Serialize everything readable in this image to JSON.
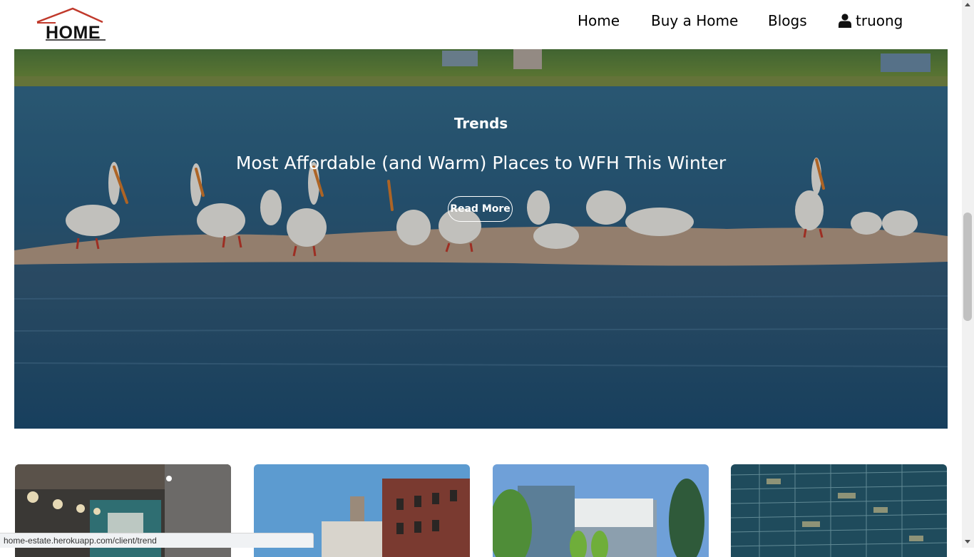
{
  "header": {
    "logo_text": "HOME",
    "nav": {
      "home": "Home",
      "buy": "Buy a Home",
      "blogs": "Blogs",
      "user": "truong"
    },
    "user_icon": "user-icon"
  },
  "hero": {
    "category": "Trends",
    "title": "Most Affordable (and Warm) Places to WFH This Winter",
    "read_more": "Read More"
  },
  "cards": [
    {
      "image": "interior-cafe"
    },
    {
      "image": "brick-buildings"
    },
    {
      "image": "glass-office"
    },
    {
      "image": "glass-tower"
    }
  ],
  "status_bar": {
    "url": "home-estate.herokuapp.com/client/trend"
  },
  "colors": {
    "logo_roof": "#c0392b",
    "water": "#2c5d7c",
    "sand": "#b49a85"
  }
}
